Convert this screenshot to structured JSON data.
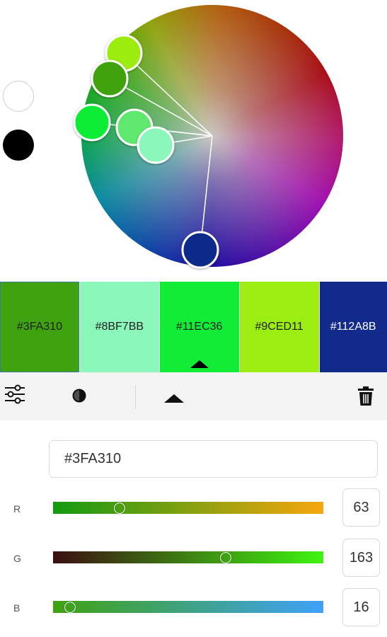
{
  "side_swatches": [
    {
      "name": "white",
      "color": "#FFFFFF"
    },
    {
      "name": "black",
      "color": "#000000"
    }
  ],
  "wheel_markers": [
    {
      "color": "#9CED11"
    },
    {
      "color": "#3FA310"
    },
    {
      "color": "#11EC36"
    },
    {
      "color": "#5EE86E"
    },
    {
      "color": "#8BF7BB"
    },
    {
      "color": "#112A8B"
    }
  ],
  "palette": [
    {
      "hex": "#3FA310",
      "color": "#3FA310",
      "active": true
    },
    {
      "hex": "#8BF7BB",
      "color": "#8BF7BB",
      "active": false
    },
    {
      "hex": "#11EC36",
      "color": "#11EC36",
      "active": false
    },
    {
      "hex": "#9CED11",
      "color": "#9CED11",
      "active": false
    },
    {
      "hex": "#112A8B",
      "color": "#112A8B",
      "active": false
    }
  ],
  "editor": {
    "hex_value": "#3FA310",
    "channels": [
      {
        "label": "R",
        "value": "63",
        "level": 0.247,
        "from": "#139a10",
        "to": "#f8a60f"
      },
      {
        "label": "G",
        "value": "163",
        "level": 0.639,
        "from": "#3b0f12",
        "to": "#3ff411"
      },
      {
        "label": "B",
        "value": "16",
        "level": 0.063,
        "from": "#3fa210",
        "to": "#3fa2f9"
      }
    ]
  }
}
